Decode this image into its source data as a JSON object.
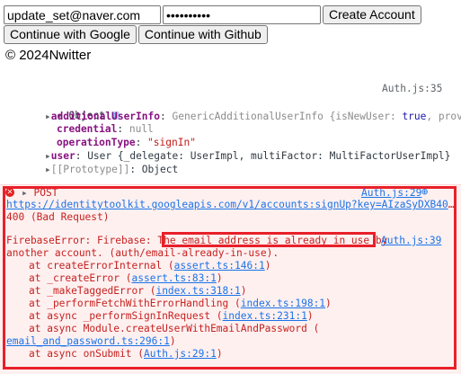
{
  "form": {
    "email_value": "update_set@naver.com",
    "password_value": "••••••••••",
    "create_label": "Create Account",
    "google_label": "Continue with Google",
    "github_label": "Continue with Github",
    "footer": "© 2024Nwitter"
  },
  "console": {
    "top_source": "Auth.js:35",
    "object_label": "Object",
    "info_icon": "i",
    "lines": {
      "additionalUserInfo_key": "additionalUserInfo",
      "additionalUserInfo_val": "GenericAdditionalUserInfo {isNewUser: ",
      "additionalUserInfo_true": "true",
      "additionalUserInfo_tail": ", prov",
      "credential_key": "credential",
      "credential_val": "null",
      "operationType_key": "operationType",
      "operationType_val": "\"signIn\"",
      "user_key": "user",
      "user_val_a": "User {_delegate: UserImpl, multiFactor: MultiFactorUserImpl}",
      "prototype": "[[Prototype]]",
      "prototype_val": "Object"
    },
    "error": {
      "method": "POST",
      "source": "Auth.js:29",
      "url": "https://identitytoolkit.googleapis.com/v1/accounts:signUp?key=AIzaSyDXB40",
      "url_ellipsis": "…",
      "status": "400 (Bad Request)",
      "msg_prefix": "FirebaseError: Firebase: ",
      "msg_highlight": "The email address is already in use by",
      "msg_source": "Auth.js:39",
      "msg_line2": "another account. (auth/email-already-in-use).",
      "stack": [
        {
          "text": "at createErrorInternal (",
          "link": "assert.ts:146:1",
          "tail": ")"
        },
        {
          "text": "at _createError (",
          "link": "assert.ts:83:1",
          "tail": ")"
        },
        {
          "text": "at _makeTaggedError (",
          "link": "index.ts:318:1",
          "tail": ")"
        },
        {
          "text": "at _performFetchWithErrorHandling (",
          "link": "index.ts:198:1",
          "tail": ")"
        },
        {
          "text": "at async _performSignInRequest (",
          "link": "index.ts:231:1",
          "tail": ")"
        },
        {
          "text": "at async Module.createUserWithEmailAndPassword (",
          "link": "",
          "tail": ""
        },
        {
          "text": "",
          "link": "email_and_password.ts:296:1",
          "tail": ")"
        },
        {
          "text": "at async onSubmit (",
          "link": "Auth.js:29:1",
          "tail": ")"
        }
      ]
    }
  },
  "colors": {
    "highlight_border": "#e8202a",
    "error_bg": "#fff0f0",
    "link": "#1a73e8"
  }
}
